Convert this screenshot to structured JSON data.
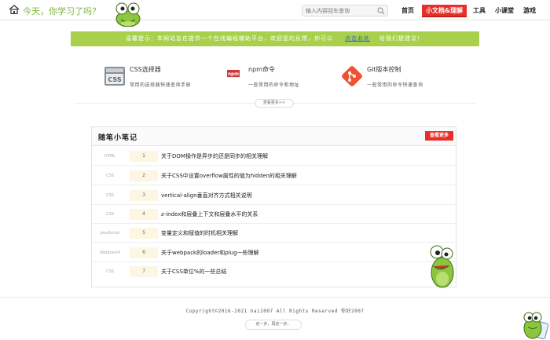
{
  "header": {
    "slogan": "今天，你学习了吗？",
    "search_placeholder": "输入内容回车查询",
    "nav": [
      {
        "label": "首页"
      },
      {
        "label": "小文档&理解"
      },
      {
        "label": "工具"
      },
      {
        "label": "小课堂"
      },
      {
        "label": "游戏"
      }
    ]
  },
  "tip": {
    "prefix": "温馨提示：本网站旨在提供一个在线编程辅助平台，欢迎您的反馈，你可以",
    "link": "点击此处",
    "suffix": "给我们提建议！"
  },
  "tools": [
    {
      "title": "CSS选择器",
      "desc": "常用的选择器快速查询手册",
      "icon": "css-icon"
    },
    {
      "title": "npm命令",
      "desc": "一些常用的命令和地址",
      "icon": "npm-icon"
    },
    {
      "title": "Git版本控制",
      "desc": "一些常用的命令快速查询",
      "icon": "git-icon"
    }
  ],
  "tools_more": "查看更多>>",
  "notes": {
    "title": "随笔小笔记",
    "more": "查看更多",
    "rows": [
      {
        "category": "HTML",
        "num": "1",
        "title": "关于DOM操作是异步的还是同步的相关理解"
      },
      {
        "category": "CSS",
        "num": "2",
        "title": "关于CSS中设置overflow属性的值为hidden的相关理解"
      },
      {
        "category": "CSS",
        "num": "3",
        "title": "vertical-align垂直对齐方式相关说明"
      },
      {
        "category": "CSS",
        "num": "4",
        "title": "z-index和层叠上下文和层叠水平的关系"
      },
      {
        "category": "JavaScript",
        "num": "5",
        "title": "变量定义和赋值的时机相关理解"
      },
      {
        "category": "Webpack4",
        "num": "6",
        "title": "关于webpack的loader和plug一些理解"
      },
      {
        "category": "CSS",
        "num": "7",
        "title": "关于CSS单位%的一些总结"
      }
    ]
  },
  "footer": {
    "copyright": "Copyright©2016-2021 hai2007 All Rights Reserved 你好2007",
    "motto": "走一步，再走一步。"
  },
  "colors": {
    "accent_red": "#e8302a",
    "green": "#a8d04c",
    "frog": "#8cc63f"
  }
}
